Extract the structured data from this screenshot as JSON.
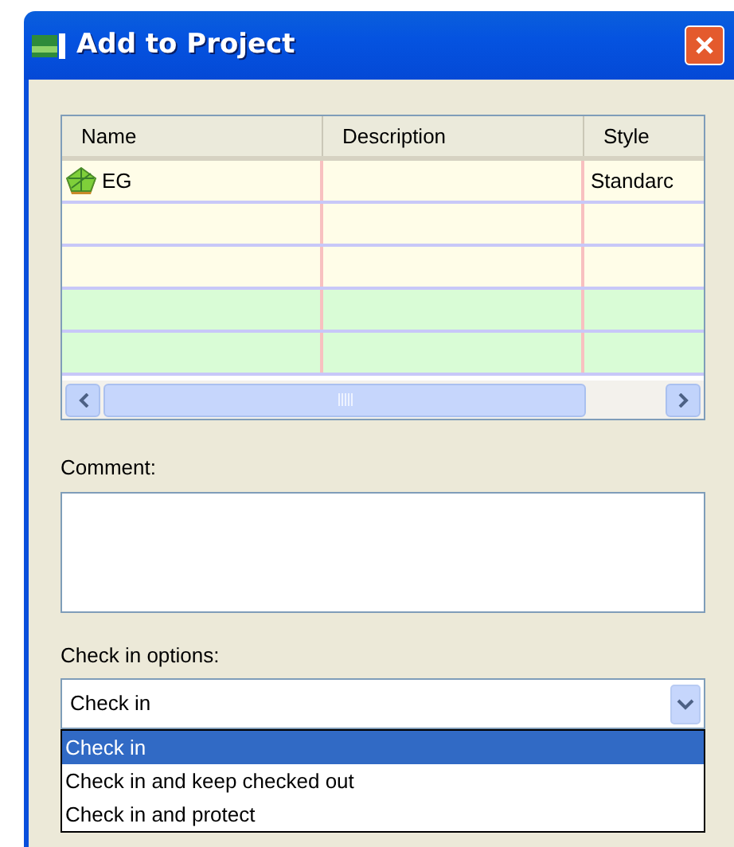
{
  "window": {
    "title": "Add to Project"
  },
  "table": {
    "columns": [
      "Name",
      "Description",
      "Style"
    ],
    "rows": [
      {
        "cells": [
          "EG",
          "",
          "Standarc"
        ],
        "has_icon": true,
        "color": "#fffde8"
      },
      {
        "cells": [
          "",
          "",
          ""
        ],
        "has_icon": false,
        "color": "#fffde8"
      },
      {
        "cells": [
          "",
          "",
          ""
        ],
        "has_icon": false,
        "color": "#fffde8"
      },
      {
        "cells": [
          "",
          "",
          ""
        ],
        "has_icon": false,
        "color": "#d9fcd6"
      },
      {
        "cells": [
          "",
          "",
          ""
        ],
        "has_icon": false,
        "color": "#d9fcd6"
      }
    ]
  },
  "comment": {
    "label": "Comment:"
  },
  "check_in_options": {
    "label": "Check in options:",
    "value": "Check in",
    "options": [
      {
        "label": "Check in",
        "selected": true
      },
      {
        "label": "Check in and keep checked out",
        "selected": false
      },
      {
        "label": "Check in and protect",
        "selected": false
      }
    ]
  }
}
